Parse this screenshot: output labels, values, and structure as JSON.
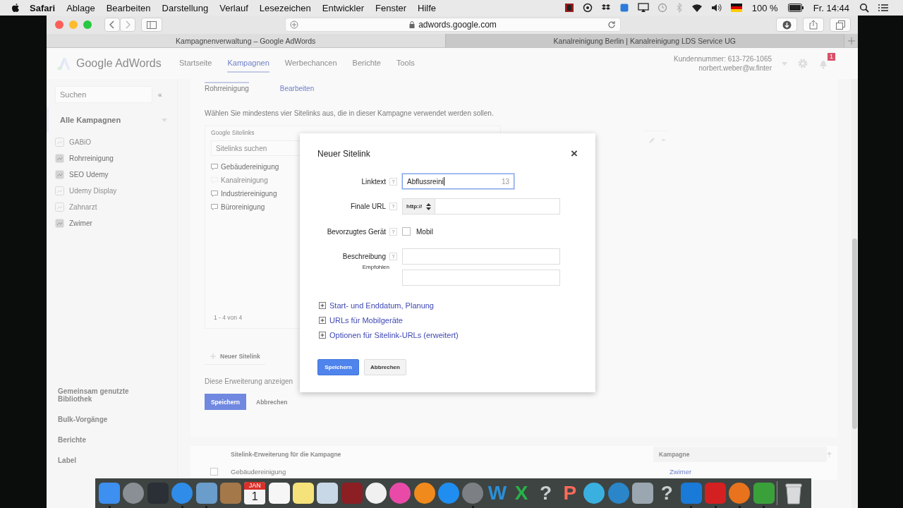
{
  "menubar": {
    "items": [
      {
        "label": "Safari",
        "bold": true
      },
      {
        "label": "Ablage",
        "bold": false
      },
      {
        "label": "Bearbeiten",
        "bold": false
      },
      {
        "label": "Darstellung",
        "bold": false
      },
      {
        "label": "Verlauf",
        "bold": false
      },
      {
        "label": "Lesezeichen",
        "bold": false
      },
      {
        "label": "Entwickler",
        "bold": false
      },
      {
        "label": "Fenster",
        "bold": false
      },
      {
        "label": "Hilfe",
        "bold": false
      }
    ],
    "battery": "100 %",
    "clock": "Fr. 14:44"
  },
  "browser": {
    "url": "adwords.google.com",
    "tabs": [
      {
        "title": "Kampagnenverwaltung – Google AdWords",
        "selected": true
      },
      {
        "title": "Kanalreinigung Berlin | Kanalreinigung LDS Service UG",
        "selected": false
      }
    ]
  },
  "adwords": {
    "logo": "Google AdWords",
    "nav": [
      {
        "label": "Startseite",
        "selected": false
      },
      {
        "label": "Kampagnen",
        "selected": true
      },
      {
        "label": "Werbechancen",
        "selected": false
      },
      {
        "label": "Berichte",
        "selected": false
      },
      {
        "label": "Tools",
        "selected": false
      }
    ],
    "customer_id": "Kundennummer: 613-726-1065",
    "email": "norbert.weber@w.finter",
    "notifications": "1"
  },
  "sidebar": {
    "search_placeholder": "Suchen",
    "collapse": "«",
    "all_campaigns": "Alle Kampagnen",
    "campaigns": [
      {
        "name": "GABiO",
        "enabled": false
      },
      {
        "name": "Rohrreinigung",
        "enabled": true
      },
      {
        "name": "SEO Udemy",
        "enabled": true
      },
      {
        "name": "Udemy Display",
        "enabled": false
      },
      {
        "name": "Zahnarzt",
        "enabled": false
      },
      {
        "name": "Zwimer",
        "enabled": true
      }
    ],
    "links": [
      "Gemeinsam genutzte Bibliothek",
      "Bulk-Vorgänge",
      "Berichte",
      "Label"
    ]
  },
  "main": {
    "breadcrumb": [
      {
        "label": "Rohrreinigung",
        "selected": true
      },
      {
        "label": "Bearbeiten",
        "selected": false
      }
    ],
    "instruction": "Wählen Sie mindestens vier Sitelinks aus, die in dieser Kampagne verwendet werden sollen.",
    "sitelinks": {
      "title": "Google Sitelinks",
      "search_placeholder": "Sitelinks suchen",
      "items": [
        {
          "label": "Gebäudereinigung",
          "disabled": false
        },
        {
          "label": "Kanalreinigung",
          "disabled": true
        },
        {
          "label": "Industriereinigung",
          "disabled": false
        },
        {
          "label": "Büroreinigung",
          "disabled": false
        }
      ],
      "count": "1 - 4 von 4",
      "new_button": "Neuer Sitelink"
    },
    "show_text": "Diese Erweiterung anzeigen",
    "save": "Speichern",
    "cancel": "Abbrechen"
  },
  "table": {
    "columns": [
      "Sitelink-Erweiterung für die Kampagne",
      "Kampagne"
    ],
    "rows": [
      {
        "checked": false,
        "cells": [
          "Gebäudereinigung",
          "Zwimer"
        ]
      }
    ]
  },
  "dialog": {
    "title": "Neuer Sitelink",
    "close": "×",
    "help": "?",
    "fields": [
      {
        "kind": "text",
        "label": "Linktext",
        "value": "Abflussreini",
        "counter": "13",
        "focused": true
      },
      {
        "kind": "url",
        "label": "Finale URL",
        "protocol": "http://"
      },
      {
        "kind": "checkbox",
        "label": "Bevorzugtes Gerät",
        "option": "Mobil",
        "checked": false
      },
      {
        "kind": "lines",
        "label": "Beschreibung",
        "sublabel": "Empfohlen"
      }
    ],
    "expanders": [
      "Start- und Enddatum, Planung",
      "URLs für Mobilgeräte",
      "Optionen für Sitelink-URLs (erweitert)"
    ],
    "save": "Speichern",
    "cancel": "Abbrechen"
  },
  "dock": [
    {
      "kind": "tile",
      "color": "#3d8ff0",
      "running": true
    },
    {
      "kind": "round",
      "color": "#8a8f96",
      "running": false
    },
    {
      "kind": "tile",
      "color": "#2b2f36",
      "running": false
    },
    {
      "kind": "round",
      "color": "#2f8ce8",
      "running": true
    },
    {
      "kind": "tile",
      "color": "#6a9ccc",
      "running": true
    },
    {
      "kind": "tile",
      "color": "#a5784a",
      "running": false
    },
    {
      "kind": "calendar",
      "color": "#f4f4f4",
      "month": "JAN",
      "day": "1",
      "running": false
    },
    {
      "kind": "tile",
      "color": "#f6f6f6",
      "running": false
    },
    {
      "kind": "tile",
      "color": "#f5e27a",
      "running": false
    },
    {
      "kind": "tile",
      "color": "#c9d8e6",
      "running": false
    },
    {
      "kind": "tile",
      "color": "#8b1f24",
      "running": false
    },
    {
      "kind": "round",
      "color": "#f0f0f0",
      "running": false
    },
    {
      "kind": "round",
      "color": "#e94aa8",
      "running": false
    },
    {
      "kind": "round",
      "color": "#f08a1c",
      "running": false
    },
    {
      "kind": "round",
      "color": "#1f8ef0",
      "running": false
    },
    {
      "kind": "round",
      "color": "#7c7f84",
      "running": true
    },
    {
      "kind": "glyph",
      "color": "#2a8fd8",
      "glyph": "W",
      "running": false
    },
    {
      "kind": "glyph",
      "color": "#27b34a",
      "glyph": "X",
      "running": false
    },
    {
      "kind": "glyph",
      "color": "#c9cdd0",
      "glyph": "?",
      "running": false
    },
    {
      "kind": "glyph",
      "color": "#ff6a5a",
      "glyph": "P",
      "running": false
    },
    {
      "kind": "round",
      "color": "#3ab0e0",
      "running": false
    },
    {
      "kind": "round",
      "color": "#2a86c8",
      "running": false
    },
    {
      "kind": "tile",
      "color": "#9aa6b0",
      "running": false
    },
    {
      "kind": "glyph",
      "color": "#c9cdd0",
      "glyph": "?",
      "running": false
    },
    {
      "kind": "tile",
      "color": "#1a7ad8",
      "running": true
    },
    {
      "kind": "tile",
      "color": "#d42020",
      "running": true
    },
    {
      "kind": "round",
      "color": "#e8731c",
      "running": true
    },
    {
      "kind": "tile",
      "color": "#3aa13a",
      "running": true
    },
    {
      "kind": "trash",
      "color": "#d8dadc",
      "running": false
    }
  ]
}
